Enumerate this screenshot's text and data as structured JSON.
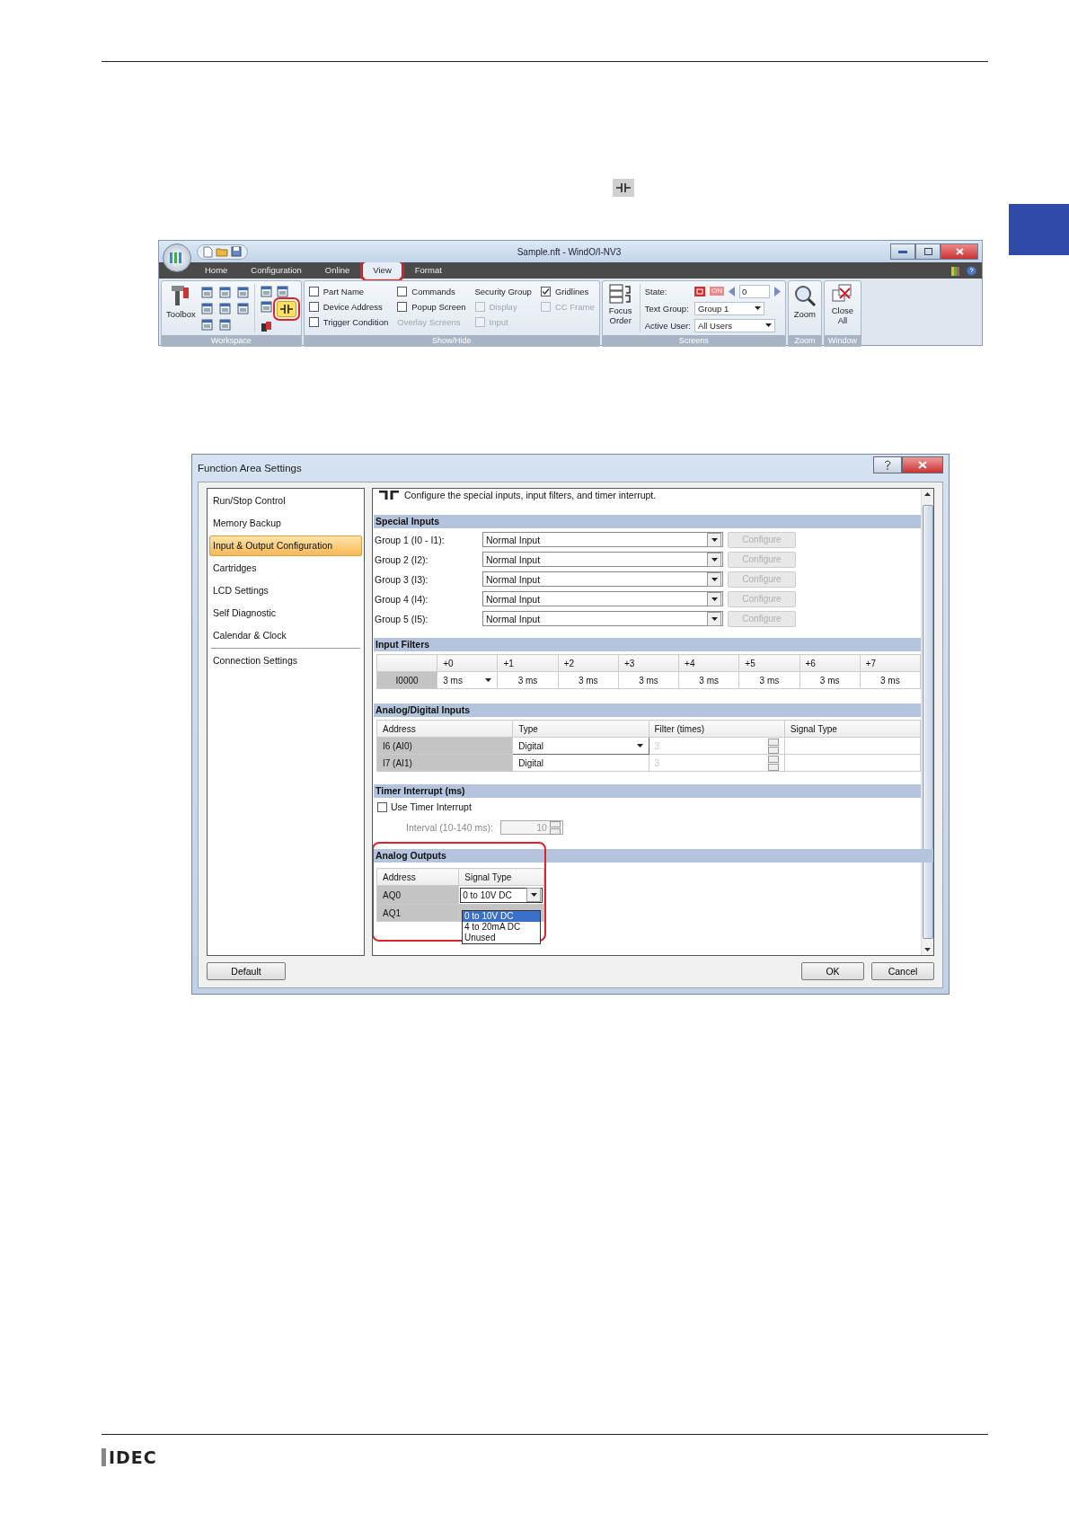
{
  "ribbon": {
    "title": "Sample.nft - WindO/I-NV3",
    "tabs": [
      {
        "label": "Home",
        "selected": false,
        "highlighted": false
      },
      {
        "label": "Configuration",
        "selected": false,
        "highlighted": false
      },
      {
        "label": "Online",
        "selected": false,
        "highlighted": false
      },
      {
        "label": "View",
        "selected": true,
        "highlighted": true
      },
      {
        "label": "Format",
        "selected": false,
        "highlighted": false
      }
    ],
    "workspace": {
      "label": "Workspace",
      "toolbox": "Toolbox",
      "contact_tool": {
        "selected": true,
        "highlighted": true
      }
    },
    "show_hide": {
      "label": "Show/Hide",
      "columns": [
        [
          {
            "kind": "checkbox",
            "label": "Part Name",
            "checked": false,
            "disabled": false
          },
          {
            "kind": "checkbox",
            "label": "Device Address",
            "checked": false,
            "disabled": false
          },
          {
            "kind": "checkbox",
            "label": "Trigger Condition",
            "checked": false,
            "disabled": false
          }
        ],
        [
          {
            "kind": "checkbox",
            "label": "Commands",
            "checked": false,
            "disabled": false
          },
          {
            "kind": "checkbox",
            "label": "Popup Screen",
            "checked": false,
            "disabled": false
          },
          {
            "kind": "text",
            "label": "Overlay Screens",
            "disabled": true
          }
        ],
        [
          {
            "kind": "text",
            "label": "Security Group",
            "disabled": false
          },
          {
            "kind": "checkbox",
            "label": "Display",
            "checked": false,
            "disabled": true
          },
          {
            "kind": "checkbox",
            "label": "Input",
            "checked": false,
            "disabled": true
          }
        ],
        [
          {
            "kind": "checkbox",
            "label": "Gridlines",
            "checked": true,
            "disabled": false
          },
          {
            "kind": "checkbox",
            "label": "CC Frame",
            "checked": false,
            "disabled": true
          }
        ]
      ]
    },
    "screens": {
      "label": "Screens",
      "focus_order": "Focus Order",
      "state_label": "State:",
      "state_on": "ON",
      "state_value": "0",
      "text_group_label": "Text Group:",
      "text_group": "Group 1",
      "active_user_label": "Active User:",
      "active_user": "All Users"
    },
    "zoom": {
      "label": "Zoom",
      "button": "Zoom"
    },
    "window": {
      "label": "Window",
      "button": "Close All"
    }
  },
  "dialog": {
    "title": "Function Area Settings",
    "nav": [
      {
        "label": "Run/Stop Control",
        "selected": false
      },
      {
        "label": "Memory Backup",
        "selected": false
      },
      {
        "label": "Input & Output Configuration",
        "selected": true
      },
      {
        "label": "Cartridges",
        "selected": false
      },
      {
        "label": "LCD Settings",
        "selected": false
      },
      {
        "label": "Self Diagnostic",
        "selected": false
      },
      {
        "label": "Calendar & Clock",
        "selected": false
      },
      {
        "label": "Connection Settings",
        "selected": false
      }
    ],
    "description": "Configure the special inputs, input filters, and timer interrupt.",
    "special_inputs": {
      "title": "Special Inputs",
      "rows": [
        {
          "label": "Group 1 (I0 - I1):",
          "value": "Normal Input",
          "button": "Configure",
          "disabled": true
        },
        {
          "label": "Group 2 (I2):",
          "value": "Normal Input",
          "button": "Configure",
          "disabled": true
        },
        {
          "label": "Group 3 (I3):",
          "value": "Normal Input",
          "button": "Configure",
          "disabled": true
        },
        {
          "label": "Group 4 (I4):",
          "value": "Normal Input",
          "button": "Configure",
          "disabled": true
        },
        {
          "label": "Group 5 (I5):",
          "value": "Normal Input",
          "button": "Configure",
          "disabled": true
        }
      ]
    },
    "input_filters": {
      "title": "Input Filters",
      "columns": [
        "+0",
        "+1",
        "+2",
        "+3",
        "+4",
        "+5",
        "+6",
        "+7"
      ],
      "row_label": "I0000",
      "values": [
        "3 ms",
        "3 ms",
        "3 ms",
        "3 ms",
        "3 ms",
        "3 ms",
        "3 ms",
        "3 ms"
      ]
    },
    "analog_inputs": {
      "title": "Analog/Digital Inputs",
      "columns": [
        "Address",
        "Type",
        "Filter (times)",
        "Signal Type"
      ],
      "rows": [
        {
          "address": "I6 (AI0)",
          "type": "Digital",
          "filter": "3"
        },
        {
          "address": "I7 (AI1)",
          "type": "Digital",
          "filter": "3"
        }
      ]
    },
    "timer_interrupt": {
      "title": "Timer Interrupt (ms)",
      "checkbox": "Use Timer Interrupt",
      "checked": false,
      "interval_label": "Interval (10-140 ms):",
      "interval": "10"
    },
    "analog_outputs": {
      "title": "Analog Outputs",
      "highlighted": true,
      "columns": [
        "Address",
        "Signal Type"
      ],
      "rows": [
        {
          "address": "AQ0",
          "value": "0 to 10V DC"
        },
        {
          "address": "AQ1"
        }
      ],
      "options": [
        {
          "label": "0 to 10V DC",
          "selected": true
        },
        {
          "label": "4 to 20mA DC",
          "selected": false
        },
        {
          "label": "Unused",
          "selected": false
        }
      ]
    },
    "buttons": {
      "default": "Default",
      "ok": "OK",
      "cancel": "Cancel"
    }
  },
  "footer": {
    "logo": "IDEC"
  }
}
